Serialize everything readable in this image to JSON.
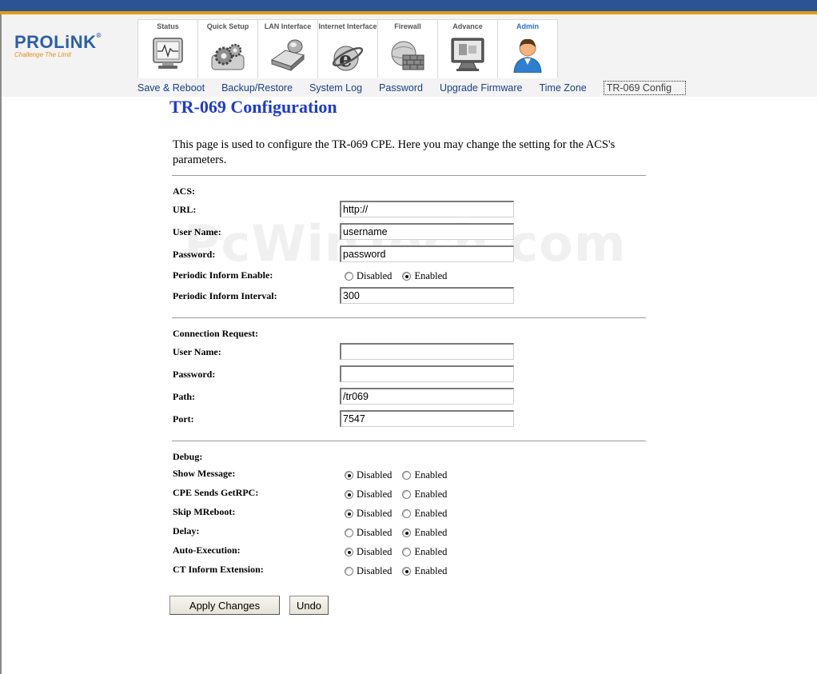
{
  "brand": {
    "logo_text": "PROLiNK",
    "logo_reg": "®",
    "tagline": "Challenge The Limit"
  },
  "tabs": [
    {
      "label": "Status",
      "icon": "monitor-pulse-icon"
    },
    {
      "label": "Quick Setup",
      "icon": "gears-icon"
    },
    {
      "label": "LAN Interface",
      "icon": "network-drive-icon"
    },
    {
      "label": "Internet Interface",
      "icon": "internet-explorer-icon"
    },
    {
      "label": "Firewall",
      "icon": "firewall-icon"
    },
    {
      "label": "Advance",
      "icon": "advance-monitor-icon"
    },
    {
      "label": "Admin",
      "icon": "admin-user-icon",
      "active": true
    }
  ],
  "subnav": [
    "Save & Reboot",
    "Backup/Restore",
    "System Log",
    "Password",
    "Upgrade Firmware",
    "Time Zone",
    "TR-069 Config"
  ],
  "page": {
    "title": "TR-069 Configuration",
    "intro": "This page is used to configure the TR-069 CPE. Here you may change the setting for the ACS's parameters."
  },
  "acs": {
    "heading": "ACS:",
    "url_label": "URL:",
    "url_value": "http://",
    "username_label": "User Name:",
    "username_value": "username",
    "password_label": "Password:",
    "password_value": "password",
    "periodic_enable_label": "Periodic Inform Enable:",
    "periodic_enable": "Enabled",
    "periodic_interval_label": "Periodic Inform Interval:",
    "periodic_interval_value": "300"
  },
  "connection": {
    "heading": "Connection Request:",
    "username_label": "User Name:",
    "username_value": "",
    "password_label": "Password:",
    "password_value": "",
    "path_label": "Path:",
    "path_value": "/tr069",
    "port_label": "Port:",
    "port_value": "7547"
  },
  "debug": {
    "heading": "Debug:",
    "rows": [
      {
        "label": "Show Message:",
        "selected": "Disabled"
      },
      {
        "label": "CPE Sends GetRPC:",
        "selected": "Disabled"
      },
      {
        "label": "Skip MReboot:",
        "selected": "Disabled"
      },
      {
        "label": "Delay:",
        "selected": "Enabled"
      },
      {
        "label": "Auto-Execution:",
        "selected": "Disabled"
      },
      {
        "label": "CT Inform Extension:",
        "selected": "Enabled"
      }
    ]
  },
  "options": {
    "disabled": "Disabled",
    "enabled": "Enabled"
  },
  "buttons": {
    "apply": "Apply Changes",
    "undo": "Undo"
  },
  "watermark": "PcWinTech.com",
  "colors": {
    "title": "#1d3bd1",
    "nav_link": "#1a3f8f",
    "topbar": "#2a5494",
    "accent": "#e39a14"
  }
}
